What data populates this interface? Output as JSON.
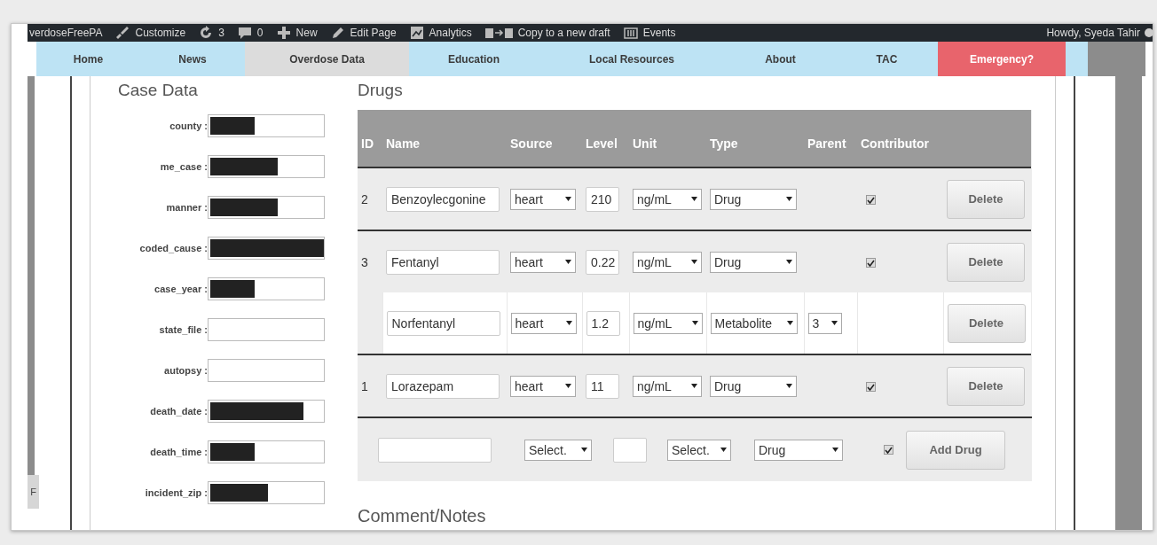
{
  "admin_bar": {
    "items": [
      {
        "kind": "site",
        "label": "verdoseFreePA"
      },
      {
        "kind": "customize",
        "label": "Customize"
      },
      {
        "kind": "updates",
        "label": "3"
      },
      {
        "kind": "comments",
        "label": "0"
      },
      {
        "kind": "new",
        "label": "New"
      },
      {
        "kind": "edit",
        "label": "Edit Page"
      },
      {
        "kind": "analytics",
        "label": "Analytics"
      },
      {
        "kind": "copy",
        "label": "Copy to a new draft"
      },
      {
        "kind": "events",
        "label": "Events"
      }
    ],
    "greeting": "Howdy, Syeda Tahir"
  },
  "nav": [
    {
      "label": "Home",
      "selected": false,
      "kind": "link"
    },
    {
      "label": "News",
      "selected": false,
      "kind": "link"
    },
    {
      "label": "Overdose Data",
      "selected": true,
      "kind": "link"
    },
    {
      "label": "Education",
      "selected": false,
      "kind": "link"
    },
    {
      "label": "Local Resources",
      "selected": false,
      "kind": "link"
    },
    {
      "label": "About",
      "selected": false,
      "kind": "link"
    },
    {
      "label": "TAC",
      "selected": false,
      "kind": "link"
    },
    {
      "label": "Emergency?",
      "selected": false,
      "kind": "emergency"
    }
  ],
  "side_tab": "F",
  "case_data": {
    "title": "Case Data",
    "fields": [
      {
        "label": "county :",
        "level": 0.39
      },
      {
        "label": "me_case :",
        "level": 0.59
      },
      {
        "label": "manner :",
        "level": 0.59
      },
      {
        "label": "coded_cause :",
        "level": 1
      },
      {
        "label": "case_year :",
        "level": 0.39
      },
      {
        "label": "state_file :"
      },
      {
        "label": "autopsy :"
      },
      {
        "label": "death_date :",
        "level": 0.82
      },
      {
        "label": "death_time :",
        "level": 0.39
      },
      {
        "label": "incident_zip :",
        "level": 0.51
      }
    ]
  },
  "drugs": {
    "title": "Drugs",
    "columns": [
      "ID",
      "Name",
      "Source",
      "Level",
      "Unit",
      "Type",
      "Parent",
      "Contributor"
    ],
    "rows": [
      {
        "kind": "drug",
        "id": "2",
        "name": "Benzoylecgonine",
        "source": "heart",
        "amount": "210",
        "unit": "ng/mL",
        "type": "Drug",
        "contributor": true,
        "button": "Delete"
      },
      {
        "kind": "drug",
        "id": "3",
        "name": "Fentanyl",
        "source": "heart",
        "amount": "0.22",
        "unit": "ng/mL",
        "type": "Drug",
        "contributor": true,
        "button": "Delete"
      },
      {
        "kind": "metabolite",
        "name": "Norfentanyl",
        "source": "heart",
        "amount": "1.2",
        "unit": "ng/mL",
        "type": "Metabolite",
        "parent": "3",
        "button": "Delete"
      },
      {
        "kind": "drug",
        "id": "1",
        "name": "Lorazepam",
        "source": "heart",
        "amount": "11",
        "unit": "ng/mL",
        "type": "Drug",
        "contributor": true,
        "button": "Delete"
      }
    ],
    "add_row": {
      "source": "Select.",
      "unit": "Select.",
      "type": "Drug",
      "contributor": true,
      "button": "Add Drug"
    }
  },
  "comment_title": "Comment/Notes"
}
